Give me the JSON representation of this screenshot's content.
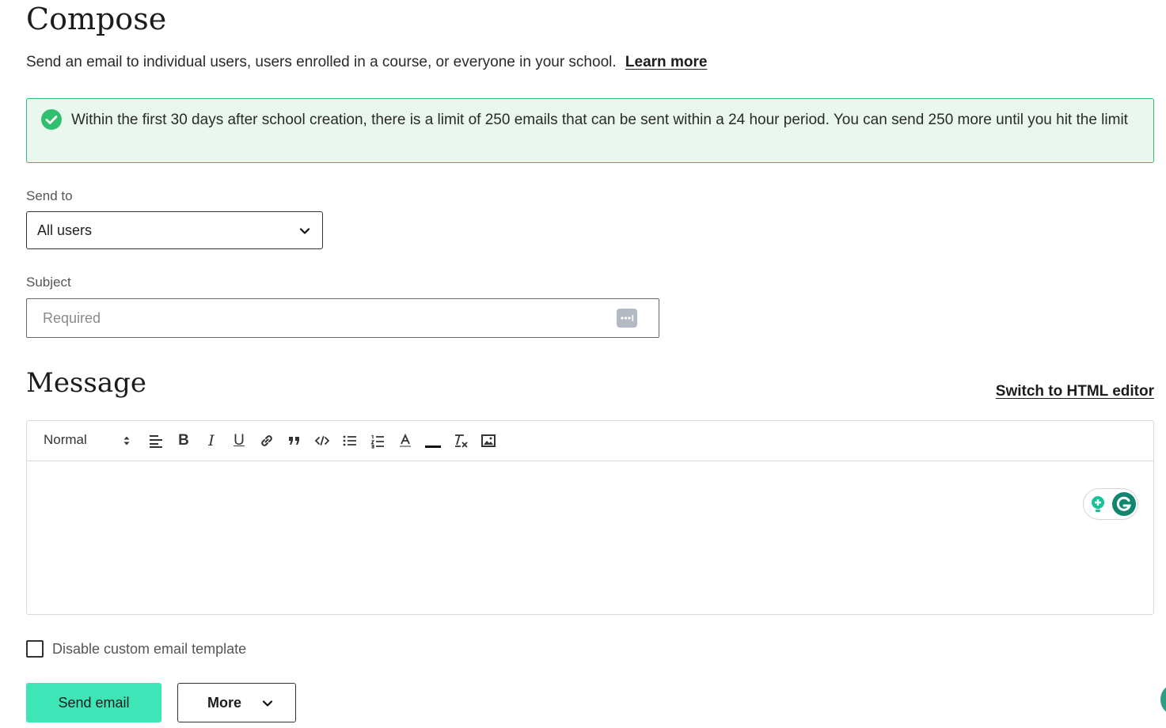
{
  "page": {
    "title": "Compose",
    "subtitle": "Send an email to individual users, users enrolled in a course, or everyone in your school.",
    "learn_more": "Learn more"
  },
  "notice": {
    "text": "Within the first 30 days after school creation, there is a limit of 250 emails that can be sent within a 24 hour period. You can send 250 more until you hit the limit",
    "icon": "check-circle-icon",
    "color": "#2fbf6f"
  },
  "send_to": {
    "label": "Send to",
    "value": "All users"
  },
  "subject": {
    "label": "Subject",
    "placeholder": "Required",
    "value": ""
  },
  "message": {
    "title": "Message",
    "switch_link": "Switch to HTML editor",
    "toolbar": {
      "format": "Normal",
      "bold": "B",
      "italic": "I",
      "underline": "U"
    }
  },
  "options": {
    "disable_template_label": "Disable custom email template",
    "disable_template_checked": false
  },
  "actions": {
    "send": "Send email",
    "more": "More"
  },
  "colors": {
    "accent": "#3ee6b7",
    "notice_bg": "#e9f7ee"
  }
}
